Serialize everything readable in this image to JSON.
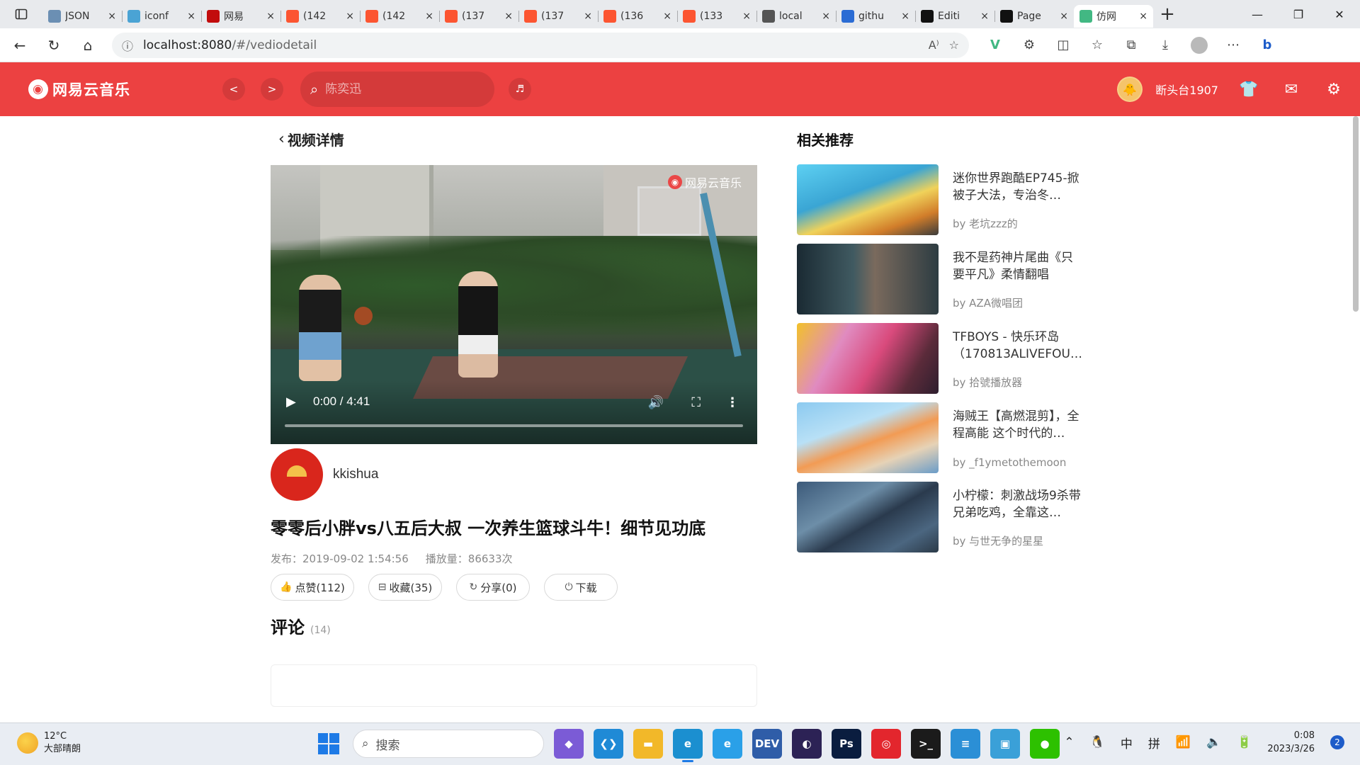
{
  "browser": {
    "tabs": [
      {
        "label": "JSON",
        "favicon": "gear-icon",
        "color": "#6b8fb3"
      },
      {
        "label": "iconf",
        "favicon": "iconfont-icon",
        "color": "#4aa3d4"
      },
      {
        "label": "网易",
        "favicon": "netease-icon",
        "color": "#c20c0c"
      },
      {
        "label": "(142",
        "favicon": "csdn-icon",
        "color": "#fc5531"
      },
      {
        "label": "(142",
        "favicon": "csdn-icon",
        "color": "#fc5531"
      },
      {
        "label": "(137",
        "favicon": "csdn-icon",
        "color": "#fc5531"
      },
      {
        "label": "(137",
        "favicon": "csdn-icon",
        "color": "#fc5531"
      },
      {
        "label": "(136",
        "favicon": "csdn-icon",
        "color": "#fc5531"
      },
      {
        "label": "(133",
        "favicon": "csdn-icon",
        "color": "#fc5531"
      },
      {
        "label": "local",
        "favicon": "page-icon",
        "color": "#555555"
      },
      {
        "label": "githu",
        "favicon": "search-icon",
        "color": "#2b6cd4"
      },
      {
        "label": "Editi",
        "favicon": "github-icon",
        "color": "#111111"
      },
      {
        "label": "Page",
        "favicon": "github-icon",
        "color": "#111111"
      },
      {
        "label": "仿网",
        "favicon": "vue-icon",
        "color": "#42b883"
      }
    ],
    "close_glyph": "×",
    "url_host": "localhost:8080",
    "url_path": "/#/vediodetail"
  },
  "app": {
    "logo_text": "网易云音乐",
    "nav_back": "<",
    "nav_forward": ">",
    "search_placeholder": "陈奕迅",
    "username": "断头台1907",
    "accent": "#ec4141"
  },
  "video_page": {
    "back_title": "视频详情",
    "watermark": "网易云音乐",
    "time": "0:00 / 4:41",
    "progress_fraction": 0,
    "author": "kkishua",
    "title": "零零后小胖vs八五后大叔 一次养生篮球斗牛！细节见功底",
    "publish": "发布：2019-09-02 1:54:56",
    "plays": "播放量：86633次",
    "actions": [
      {
        "label": "点赞(112)",
        "icon": "thumbs-up-icon",
        "glyph": "👍",
        "name": "like-button",
        "width": 118
      },
      {
        "label": "收藏(35)",
        "icon": "collect-icon",
        "glyph": "⊟",
        "name": "collect-button",
        "width": 104
      },
      {
        "label": "分享(0)",
        "icon": "share-icon",
        "glyph": "↻",
        "name": "share-button",
        "width": 104
      },
      {
        "label": "下载",
        "icon": "download-icon",
        "glyph": "⏻",
        "name": "download-button",
        "width": 104
      }
    ],
    "comments_heading": "评论",
    "comments_count": "(14)"
  },
  "recommend": {
    "title": "相关推荐",
    "items": [
      {
        "name": "迷你世界跑酷EP745-掀被子大法，专治冬…",
        "by": "by 老坑zzz的"
      },
      {
        "name": "我不是药神片尾曲《只要平凡》柔情翻唱",
        "by": "by AZA微唱团"
      },
      {
        "name": "TFBOYS - 快乐环岛（170813ALIVEFOU…",
        "by": "by 拾號播放器"
      },
      {
        "name": "海贼王【高燃混剪】，全程高能 这个时代的…",
        "by": "by _f1ymetothemoon"
      },
      {
        "name": "小柠檬：刺激战场9杀带兄弟吃鸡，全靠这…",
        "by": "by 与世无争的星星"
      }
    ]
  },
  "taskbar": {
    "temp": "12°C",
    "weather": "大部晴朗",
    "search": "搜索",
    "ime1": "中",
    "ime2": "拼",
    "time": "0:08",
    "date": "2023/3/26",
    "notifications": "2",
    "apps": [
      {
        "name": "visual-studio-icon",
        "color": "#7b5bd6",
        "glyph": "◆"
      },
      {
        "name": "vscode-icon",
        "color": "#1f8ad6",
        "glyph": "❮❯"
      },
      {
        "name": "file-explorer-icon",
        "color": "#f2b829",
        "glyph": "▬"
      },
      {
        "name": "edge-icon",
        "color": "#1b8fd0",
        "glyph": "e",
        "active": true
      },
      {
        "name": "ie-icon",
        "color": "#2aa0e8",
        "glyph": "e"
      },
      {
        "name": "devc-icon",
        "color": "#2f5da8",
        "glyph": "DEV"
      },
      {
        "name": "eclipse-icon",
        "color": "#2c2255",
        "glyph": "◐"
      },
      {
        "name": "photoshop-icon",
        "color": "#0a1d3f",
        "glyph": "Ps"
      },
      {
        "name": "netease-music-icon",
        "color": "#e3262d",
        "glyph": "◎"
      },
      {
        "name": "terminal-icon",
        "color": "#1b1b1b",
        "glyph": ">_"
      },
      {
        "name": "notepad-icon",
        "color": "#2b8fd6",
        "glyph": "≡"
      },
      {
        "name": "snipping-icon",
        "color": "#3aa0d8",
        "glyph": "▣"
      },
      {
        "name": "wechat-icon",
        "color": "#2dc100",
        "glyph": "●"
      }
    ]
  }
}
